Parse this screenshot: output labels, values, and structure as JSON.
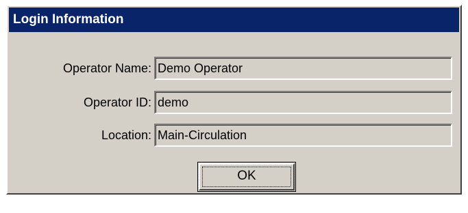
{
  "window": {
    "title": "Login Information"
  },
  "form": {
    "operator_name": {
      "label": "Operator Name:",
      "value": "Demo Operator"
    },
    "operator_id": {
      "label": "Operator ID:",
      "value": "demo"
    },
    "location": {
      "label": "Location:",
      "value": "Main-Circulation"
    }
  },
  "buttons": {
    "ok_label": "OK"
  },
  "colors": {
    "titlebar": "#0a246a",
    "dialog_face": "#d4d0c8"
  }
}
